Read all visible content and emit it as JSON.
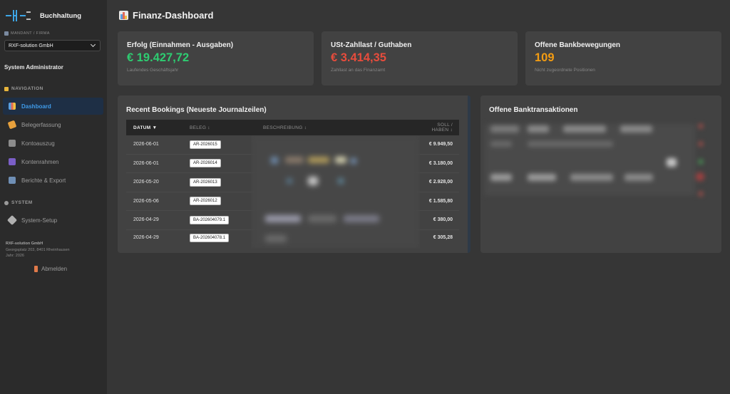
{
  "app": {
    "title": "Buchhaltung"
  },
  "sidebar": {
    "mandant_label": "MANDANT / FIRMA",
    "mandant_value": "RXF-solution GmbH",
    "user": "System Administrator",
    "nav_header": "NAVIGATION",
    "nav": [
      {
        "label": "Dashboard",
        "icon": "bar-chart-icon",
        "active": true
      },
      {
        "label": "Belegerfassung",
        "icon": "pen-icon",
        "active": false
      },
      {
        "label": "Kontoauszug",
        "icon": "bank-icon",
        "active": false
      },
      {
        "label": "Kontenrahmen",
        "icon": "book-icon",
        "active": false
      },
      {
        "label": "Berichte & Export",
        "icon": "line-chart-icon",
        "active": false
      }
    ],
    "system_header": "SYSTEM",
    "system_item": "System-Setup",
    "company": {
      "name": "RXF-solution GmbH",
      "address": "Georgsplatz 203, 8401 Rheinhausen",
      "year": "Jahr: 2026"
    },
    "logout": "Abmelden"
  },
  "page": {
    "title": "Finanz-Dashboard"
  },
  "kpis": [
    {
      "title": "Erfolg (Einnahmen - Ausgaben)",
      "value": "€ 19.427,72",
      "sub": "Laufendes Geschäftsjahr",
      "color": "#2ecc71"
    },
    {
      "title": "USt-Zahllast / Guthaben",
      "value": "€ 3.414,35",
      "sub": "Zahllast an das Finanzamt",
      "color": "#e74c3c"
    },
    {
      "title": "Offene Bankbewegungen",
      "value": "109",
      "sub": "Nicht zugeordnete Positionen",
      "color": "#f39c12"
    }
  ],
  "bookings": {
    "title": "Recent Bookings (Neueste Journalzeilen)",
    "headers": {
      "datum": "DATUM ▼",
      "beleg": "BELEG ↕",
      "beschreibung": "BESCHREIBUNG ↕",
      "betrag": "SOLL / HABEN ↕"
    },
    "rows": [
      {
        "datum": "2026-06-01",
        "beleg": "AR-2026015",
        "betrag": "€ 9.949,50"
      },
      {
        "datum": "2026-06-01",
        "beleg": "AR-2026014",
        "betrag": "€ 3.180,00"
      },
      {
        "datum": "2026-05-20",
        "beleg": "AR-2026013",
        "betrag": "€ 2.928,00"
      },
      {
        "datum": "2026-05-06",
        "beleg": "AR-2026012",
        "betrag": "€ 1.585,80"
      },
      {
        "datum": "2026-04-29",
        "beleg": "BA-202604079.1",
        "betrag": "€ 380,00"
      },
      {
        "datum": "2026-04-29",
        "beleg": "BA-202604078.1",
        "betrag": "€ 305,28"
      }
    ]
  },
  "bank": {
    "title": "Offene Banktransaktionen"
  },
  "colors": {
    "accent": "#3f9ae8",
    "positive": "#2ecc71",
    "negative": "#e74c3c",
    "warning": "#f39c12"
  }
}
